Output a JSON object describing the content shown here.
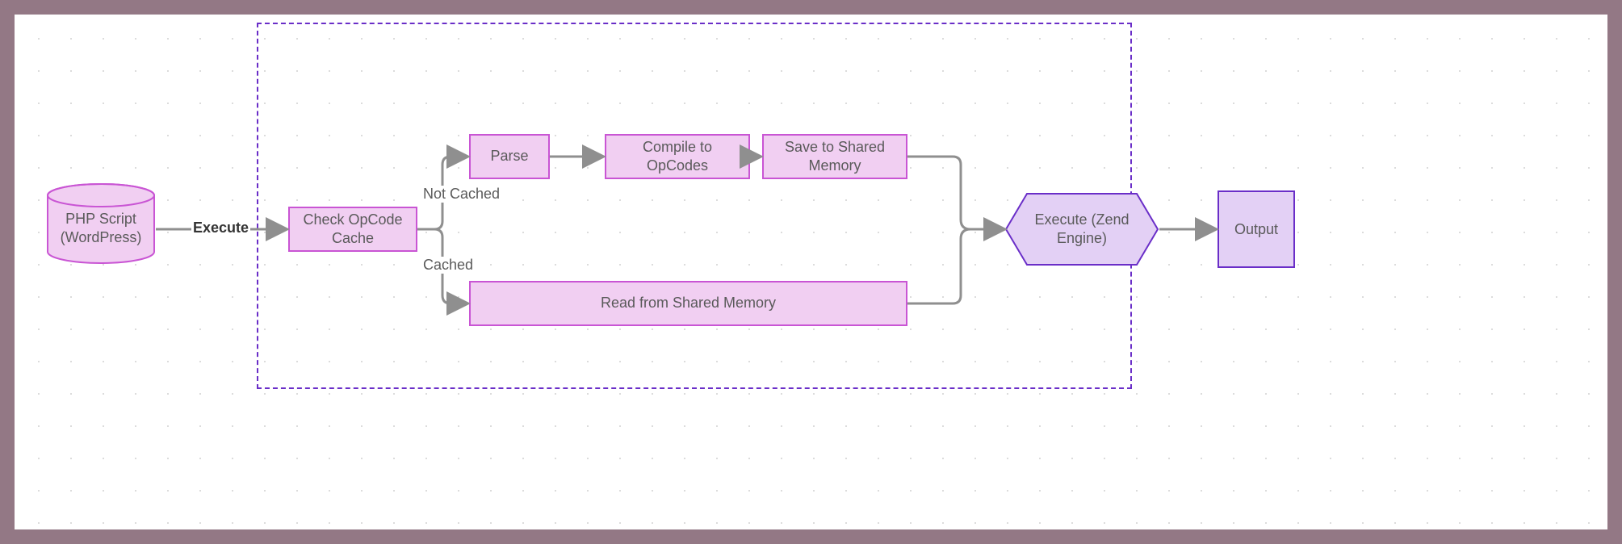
{
  "nodes": {
    "php_script": "PHP Script\n(WordPress)",
    "check_cache": "Check OpCode Cache",
    "parse": "Parse",
    "compile": "Compile to OpCodes",
    "save_mem": "Save to Shared Memory",
    "read_mem": "Read from Shared Memory",
    "execute": "Execute (Zend\nEngine)",
    "output": "Output"
  },
  "edges": {
    "execute_label": "Execute",
    "not_cached": "Not Cached",
    "cached": "Cached"
  },
  "colors": {
    "node_fill": "#f1cff2",
    "node_stroke": "#c955d4",
    "hex_stroke": "#6a2ec8",
    "hex_fill": "#e3d0f5",
    "arrow": "#8f8f8f"
  }
}
